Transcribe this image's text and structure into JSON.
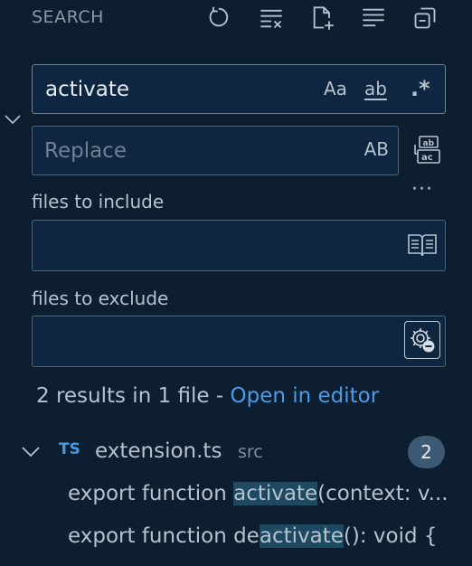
{
  "header": {
    "title": "SEARCH"
  },
  "icons": {
    "toolbar": [
      "refresh-icon",
      "clear-results-icon",
      "new-search-editor-icon",
      "view-as-tree-icon",
      "collapse-all-icon"
    ],
    "replace_all": "replace-all-icon",
    "book": "open-editors-book-icon",
    "gear": "exclude-settings-gear-icon"
  },
  "search": {
    "value": "activate",
    "match_case_label": "Aa",
    "whole_word_label": "ab",
    "regex_label": ".*"
  },
  "replace": {
    "placeholder": "Replace",
    "preserve_case_label": "AB",
    "more_label": "···"
  },
  "include": {
    "label": "files to include",
    "value": ""
  },
  "exclude": {
    "label": "files to exclude",
    "value": ""
  },
  "results": {
    "summary": "2 results in 1 file - ",
    "open_in_editor": "Open in editor",
    "files": [
      {
        "type_label": "TS",
        "name": "extension.ts",
        "dir": "src",
        "count": "2",
        "matches": [
          {
            "before": "export function ",
            "match": "activate",
            "after": "(context: v..."
          },
          {
            "before": "export function de",
            "match": "activate",
            "after": "(): void {"
          }
        ]
      }
    ]
  },
  "colors": {
    "background": "#0c1e30",
    "input_bg": "#0f2640",
    "link": "#4d9be6",
    "match_highlight": "#1d4a60",
    "badge": "#3e5a72",
    "ts_icon": "#4a9ae0"
  }
}
